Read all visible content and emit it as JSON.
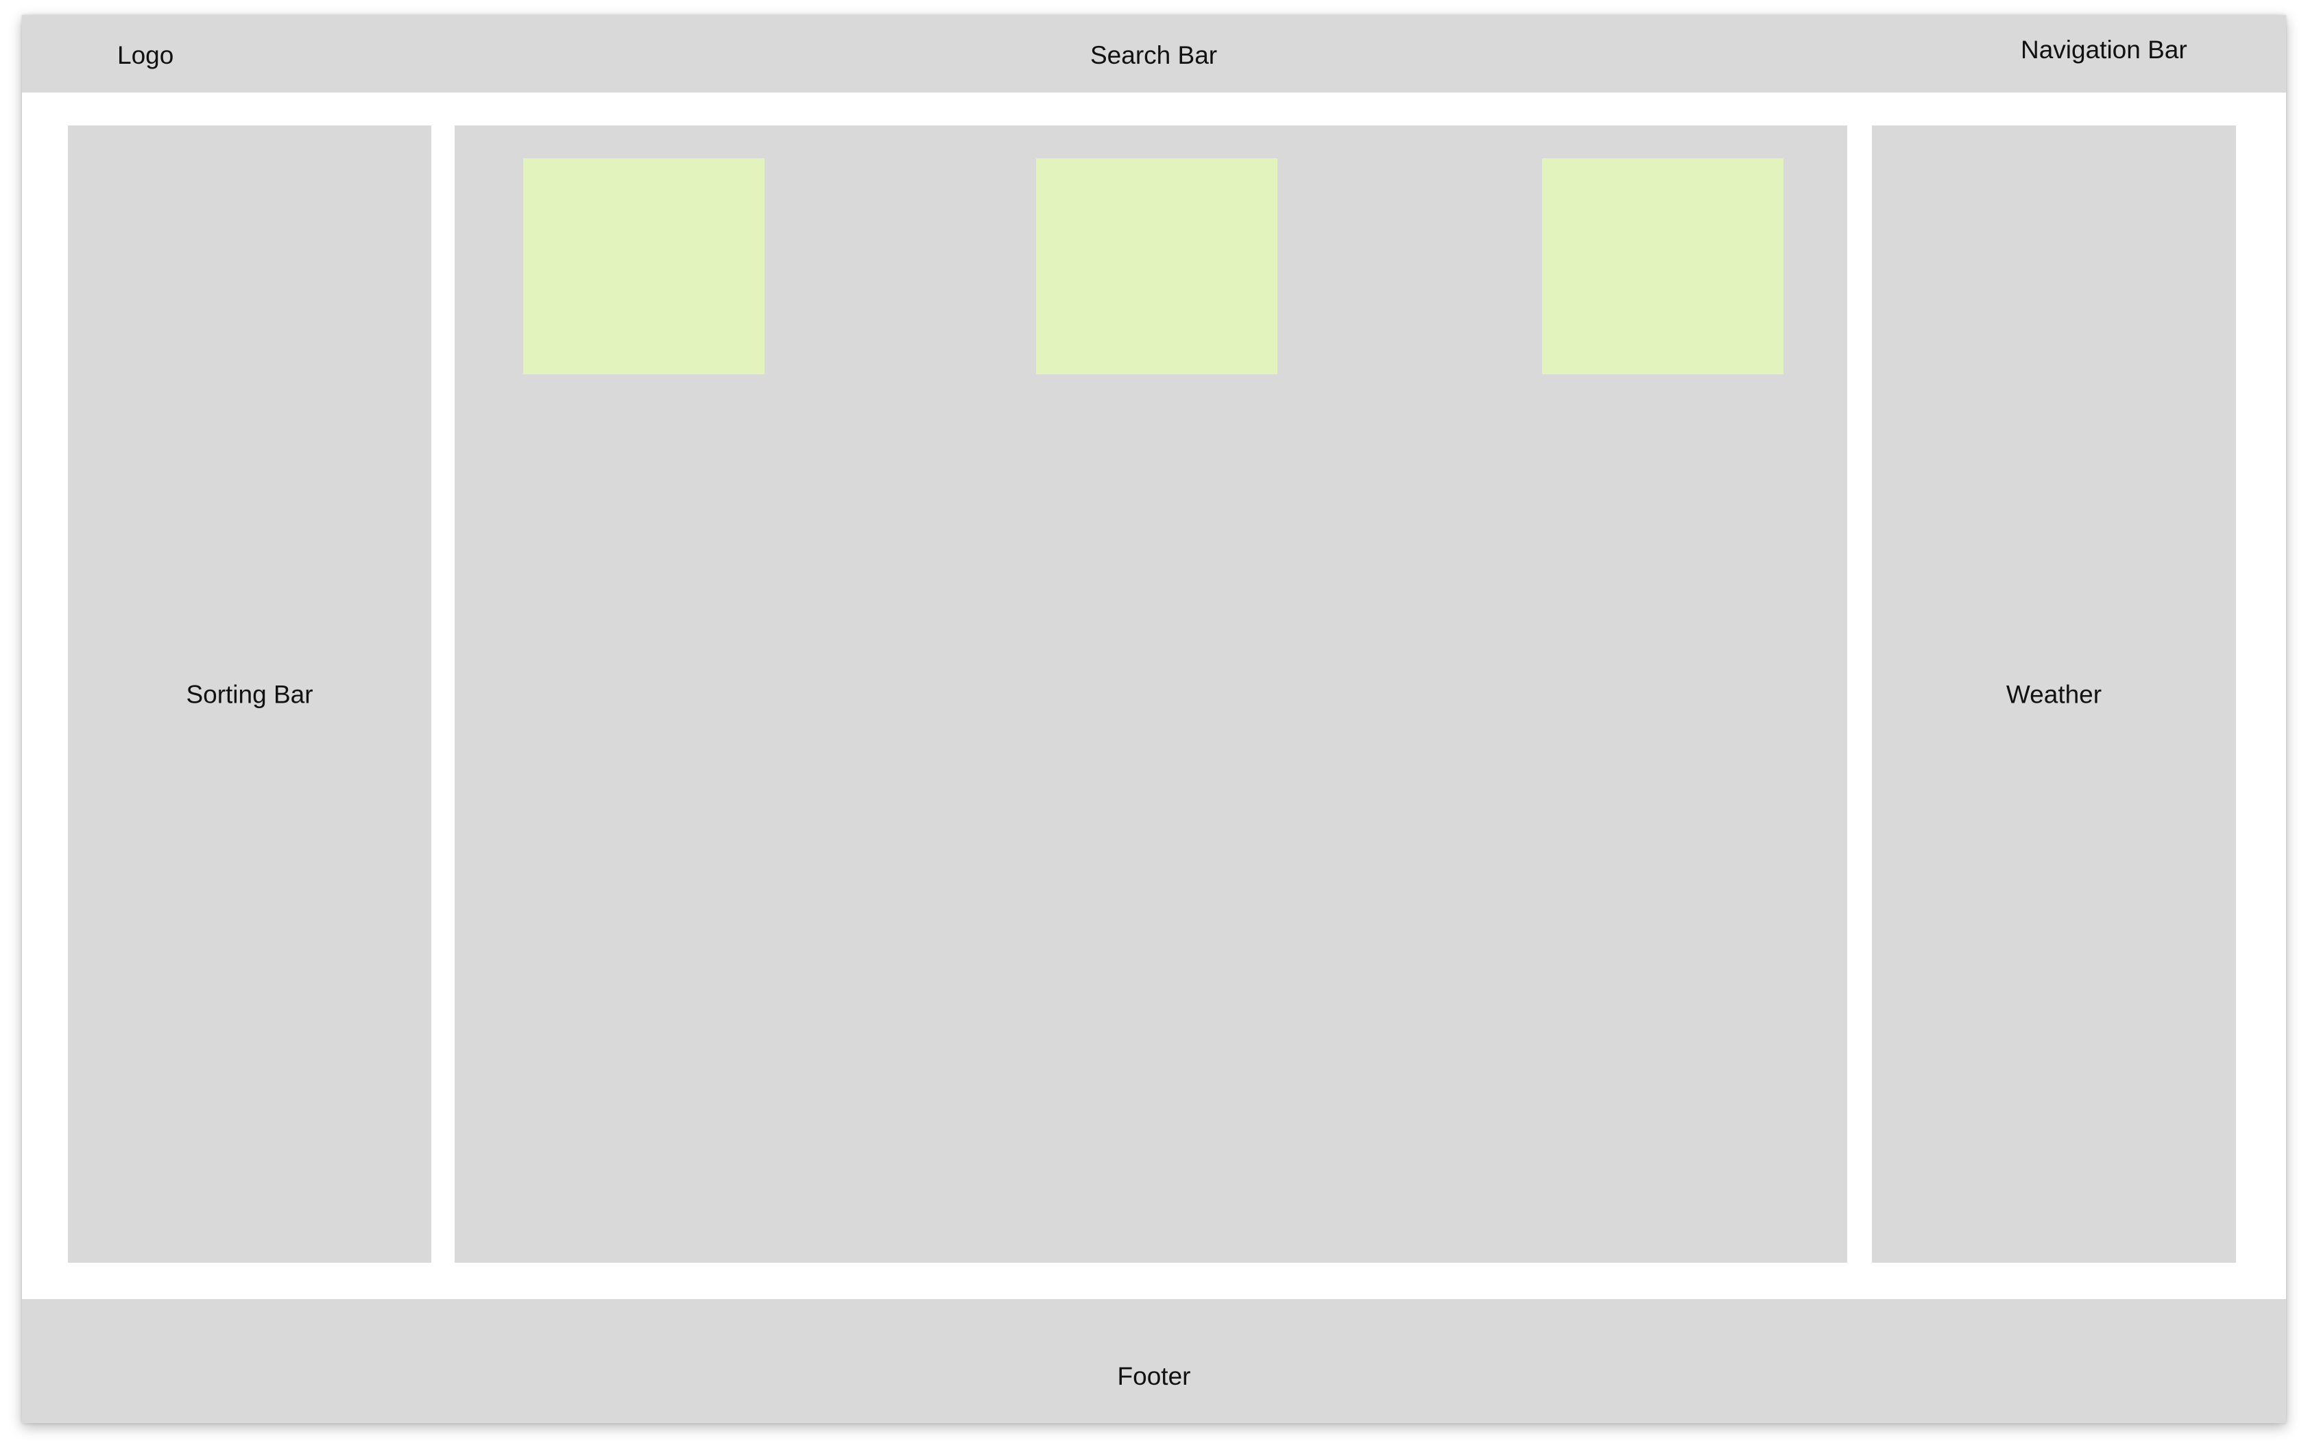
{
  "header": {
    "logo": "Logo",
    "search": "Search Bar",
    "navigation": "Navigation Bar"
  },
  "sidebar_left": {
    "label": "Sorting Bar"
  },
  "main": {
    "cards": [
      {
        "label": ""
      },
      {
        "label": ""
      },
      {
        "label": ""
      }
    ]
  },
  "sidebar_right": {
    "label": "Weather"
  },
  "footer": {
    "label": "Footer"
  },
  "colors": {
    "block": "#d9d9d9",
    "card": "#e3f3bd",
    "background": "#ffffff"
  }
}
